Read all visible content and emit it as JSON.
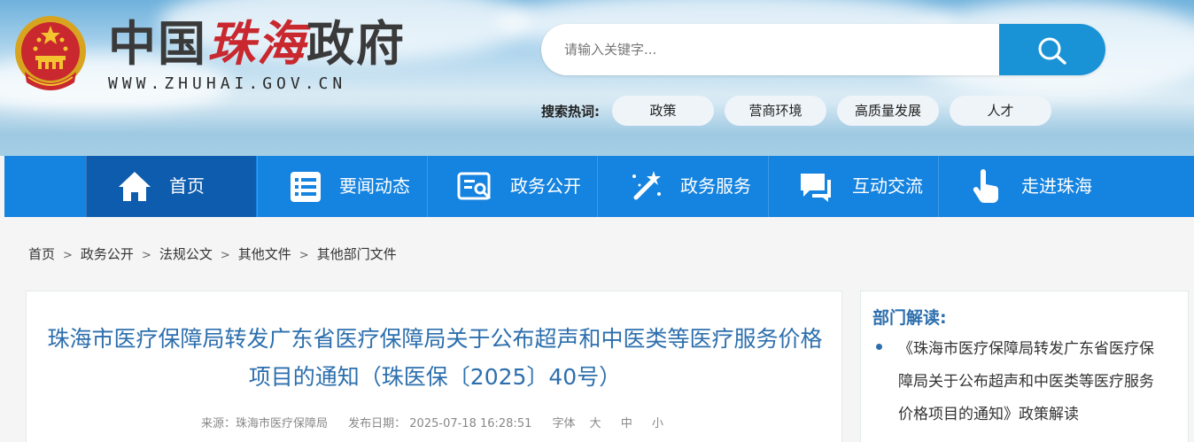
{
  "header": {
    "title_part1": "中国",
    "title_part2": "珠海",
    "title_part3": "政府",
    "url": "WWW.ZHUHAI.GOV.CN",
    "search_placeholder": "请输入关键字...",
    "hot_label": "搜索热词:",
    "hot_tags": [
      "政策",
      "营商环境",
      "高质量发展",
      "人才"
    ]
  },
  "nav": {
    "items": [
      {
        "label": "首页",
        "icon": "home-icon",
        "active": true
      },
      {
        "label": "要闻动态",
        "icon": "list-icon"
      },
      {
        "label": "政务公开",
        "icon": "document-search-icon"
      },
      {
        "label": "政务服务",
        "icon": "magic-wand-icon"
      },
      {
        "label": "互动交流",
        "icon": "chat-icon"
      },
      {
        "label": "走进珠海",
        "icon": "hand-pointer-icon"
      }
    ]
  },
  "breadcrumb": [
    "首页",
    "政务公开",
    "法规公文",
    "其他文件",
    "其他部门文件"
  ],
  "article": {
    "title": "珠海市医疗保障局转发广东省医疗保障局关于公布超声和中医类等医疗服务价格项目的通知（珠医保〔2025〕40号）",
    "source": "来源：珠海市医疗保障局",
    "date": "发布日期： 2025-07-18 16:28:51",
    "font_label": "字体",
    "size_large": "大",
    "size_medium": "中",
    "size_small": "小"
  },
  "side": {
    "title": "部门解读:",
    "link": "《珠海市医疗保障局转发广东省医疗保障局关于公布超声和中医类等医疗服务价格项目的通知》政策解读"
  },
  "colors": {
    "nav_bg": "#1583e0",
    "nav_active": "#0e5cae",
    "search_button": "#1a93d6",
    "title_blue": "#2d6fad",
    "brand_red": "#c8282e"
  }
}
